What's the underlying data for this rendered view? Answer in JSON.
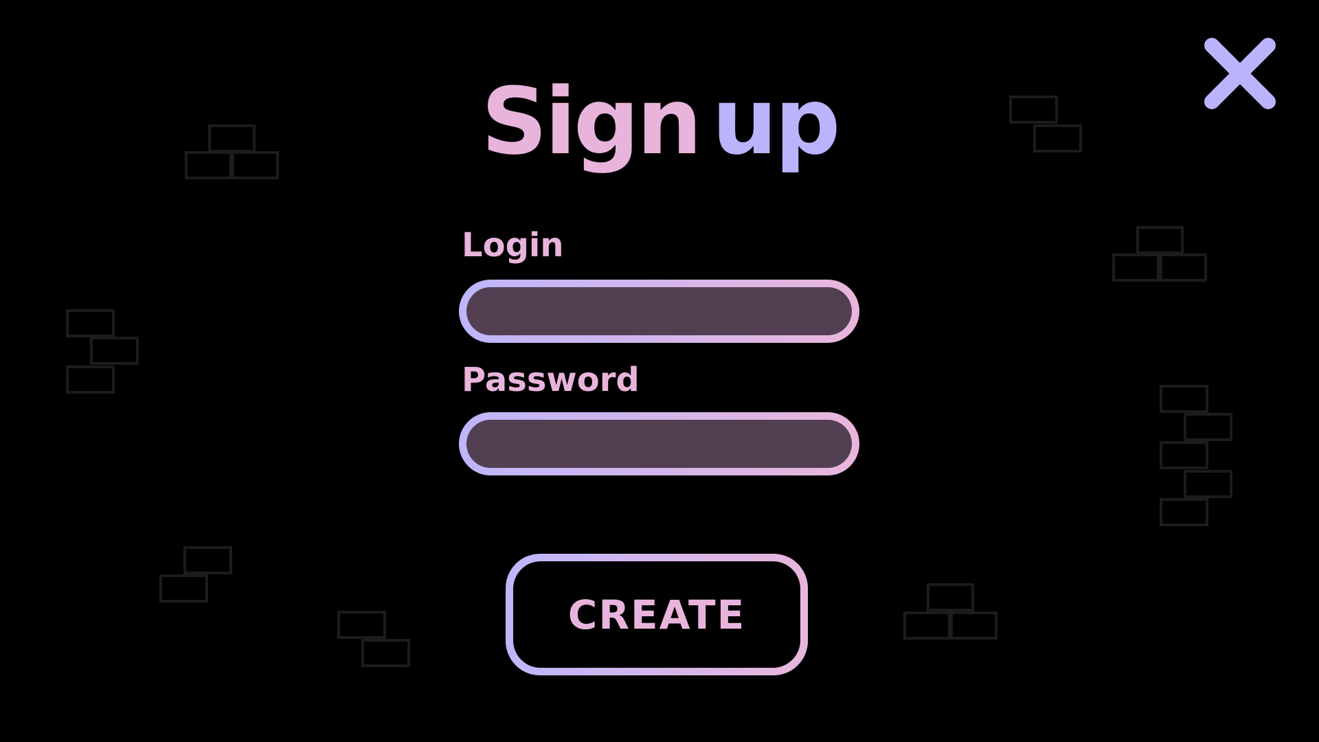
{
  "title": {
    "word1": "Sign",
    "word2": "up"
  },
  "close_icon": "close-icon",
  "login": {
    "label": "Login",
    "value": "",
    "placeholder": ""
  },
  "password": {
    "label": "Password",
    "value": "",
    "placeholder": ""
  },
  "create_button": {
    "label": "CREATE"
  },
  "colors": {
    "background": "#000000",
    "pink": "#e8b4dc",
    "lavender": "#b9b4fb",
    "field_fill": "#523f52",
    "brick_outline": "#1c1c1c"
  }
}
